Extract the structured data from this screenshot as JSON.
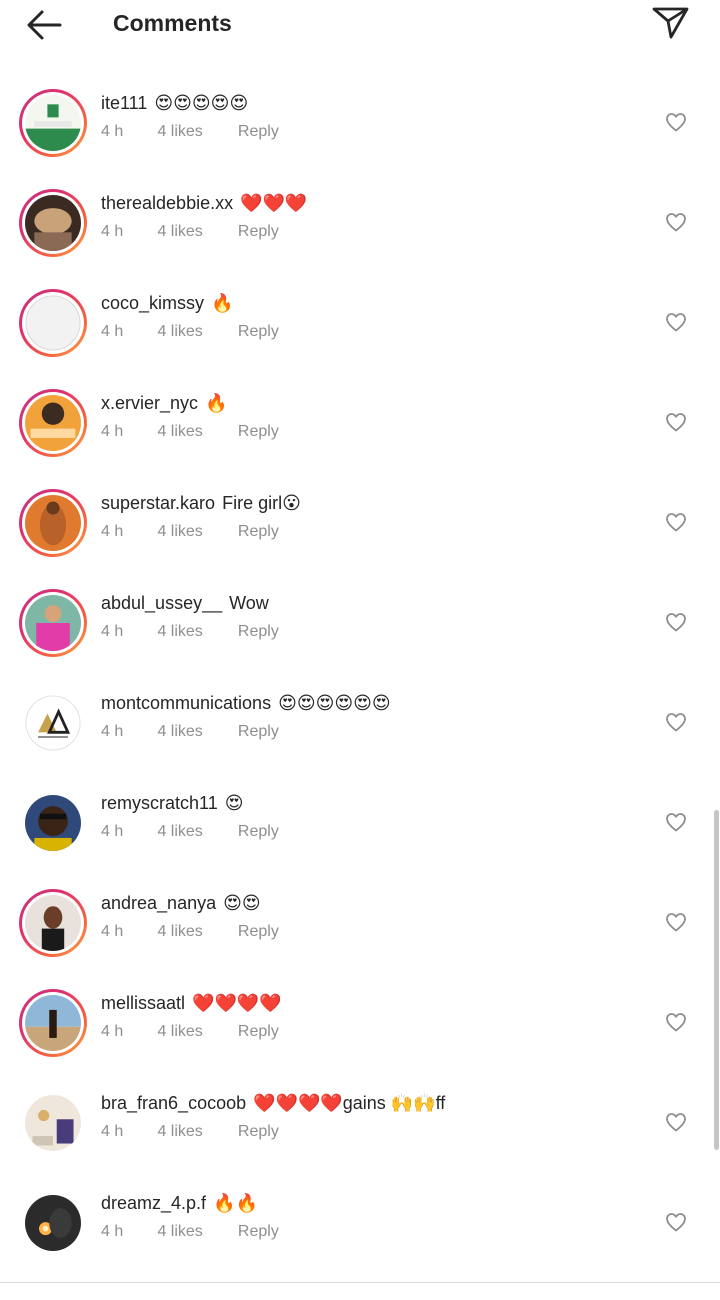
{
  "header": {
    "title": "Comments",
    "back_icon": "arrow-left-icon",
    "send_icon": "send-icon"
  },
  "colors": {
    "text": "#262626",
    "meta": "#8e8e8e",
    "story_ring_start": "#c13584",
    "story_ring_end": "#fcaf45"
  },
  "comments": [
    {
      "username": "ite111",
      "text": "😍😍😍😍😍",
      "time": "4 h",
      "likes": "4 likes",
      "reply": "Reply"
    },
    {
      "username": "therealdebbie.xx",
      "text": "❤️❤️❤️",
      "time": "4 h",
      "likes": "4 likes",
      "reply": "Reply"
    },
    {
      "username": "coco_kimssy",
      "text": "🔥",
      "time": "4 h",
      "likes": "4 likes",
      "reply": "Reply"
    },
    {
      "username": "x.ervier_nyc",
      "text": "🔥",
      "time": "4 h",
      "likes": "4 likes",
      "reply": "Reply"
    },
    {
      "username": "superstar.karo",
      "text": "Fire girl😮",
      "time": "4 h",
      "likes": "4 likes",
      "reply": "Reply"
    },
    {
      "username": "abdul_ussey__",
      "text": "Wow",
      "time": "4 h",
      "likes": "4 likes",
      "reply": "Reply"
    },
    {
      "username": "montcommunications",
      "text": "😍😍😍😍😍😍",
      "time": "4 h",
      "likes": "4 likes",
      "reply": "Reply"
    },
    {
      "username": "remyscratch11",
      "text": "😍",
      "time": "4 h",
      "likes": "4 likes",
      "reply": "Reply"
    },
    {
      "username": "andrea_nanya",
      "text": "😍😍",
      "time": "4 h",
      "likes": "4 likes",
      "reply": "Reply"
    },
    {
      "username": "mellissaatl",
      "text": "❤️❤️❤️❤️",
      "time": "4 h",
      "likes": "4 likes",
      "reply": "Reply"
    },
    {
      "username": "bra_fran6_cocoob",
      "text": "❤️❤️❤️❤️gains 🙌🙌ff",
      "time": "4 h",
      "likes": "4 likes",
      "reply": "Reply"
    },
    {
      "username": "dreamz_4.p.f",
      "text": "🔥🔥",
      "time": "4 h",
      "likes": "4 likes",
      "reply": "Reply"
    }
  ]
}
